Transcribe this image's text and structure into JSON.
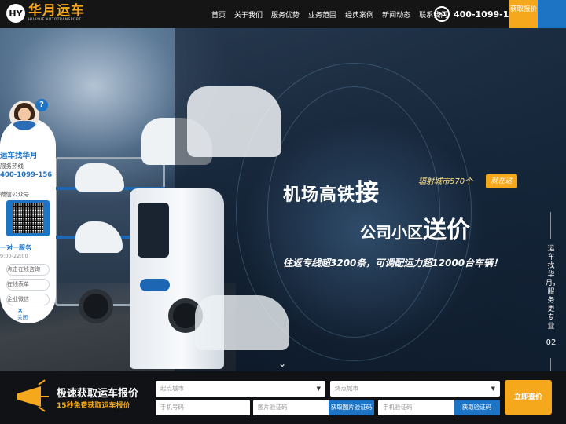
{
  "header": {
    "logo_mark": "HY",
    "logo_cn": "华月运车",
    "logo_en": "HUAYUE AUTOTRANSPORT",
    "nav": [
      "首页",
      "关于我们",
      "服务优势",
      "业务范围",
      "经典案例",
      "新闻动态",
      "联系我们"
    ],
    "phone_badge": "24",
    "phone": "400-1099-156",
    "quote_button": "获取报价"
  },
  "hero": {
    "line1": "机场高铁",
    "line1_big": "接",
    "line1_tag": "辐射城市570个",
    "line1_button": "就在这",
    "line2": "公司小区",
    "line2_big": "送价",
    "line3": "往返专线超3200条，可调配运力超12000台车辆！"
  },
  "side_panel": {
    "title": "运车找华月",
    "hotline_label": "服务热线",
    "hotline": "400-1099-156",
    "wechat_label": "微信公众号",
    "service_title": "一对一服务",
    "hours": "9:00-22:00",
    "buttons": [
      "点击在线咨询",
      "在线表单",
      "企业微信"
    ],
    "close_label": "关闭"
  },
  "right_rail": {
    "vertical_text": "运车找华月，服务更专业",
    "slide_number": "02"
  },
  "quote_bar": {
    "title": "极速获取运车报价",
    "subtitle": "15秒免费获取运车报价",
    "origin_placeholder": "起点城市",
    "destination_placeholder": "终点城市",
    "phone_placeholder": "手机号码",
    "image_code_placeholder": "图片验证码",
    "image_code_button": "获取图片验证码",
    "sms_code_placeholder": "手机验证码",
    "sms_code_button": "获取验证码",
    "submit": "立即查价"
  },
  "colors": {
    "accent": "#f6a81c",
    "brand_blue": "#1d73c4",
    "header_bg": "#151515"
  }
}
